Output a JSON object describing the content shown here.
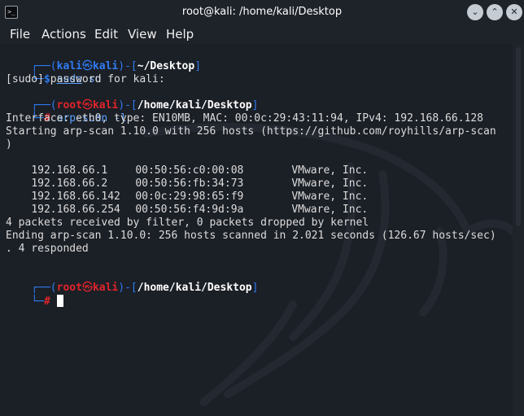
{
  "window": {
    "title": "root@kali: /home/kali/Desktop",
    "app_icon_glyph": ">_",
    "controls": [
      "minimize",
      "maximize",
      "close"
    ]
  },
  "menu": [
    "File",
    "Actions",
    "Edit",
    "View",
    "Help"
  ],
  "glyphs": {
    "top_connector": "┌──",
    "bottom_connector": "└─",
    "dash": "-",
    "open_bracket": "[",
    "close_bracket": "]",
    "open_paren": "(",
    "close_paren": ")",
    "skull": "㉿"
  },
  "prompts": [
    {
      "user": "kali",
      "host": "kali",
      "path": "~/Desktop",
      "symbol": "$"
    },
    {
      "user": "root",
      "host": "kali",
      "path": "/home/kali/Desktop",
      "symbol": "#"
    },
    {
      "user": "root",
      "host": "kali",
      "path": "/home/kali/Desktop",
      "symbol": "#"
    }
  ],
  "commands": {
    "c1_word1": "sudo",
    "c1_word2": " su",
    "c2": "arp-scan -l"
  },
  "output": {
    "sudo_prompt": "[sudo] password for kali:",
    "interface": "Interface: eth0, type: EN10MB, MAC: 00:0c:29:43:11:94, IPv4: 192.168.66.128",
    "starting": "Starting arp-scan 1.10.0 with 256 hosts (https://github.com/royhills/arp-scan",
    "starting_wrap": ")",
    "hosts": [
      {
        "ip": "192.168.66.1",
        "mac": "00:50:56:c0:00:08",
        "vendor": "VMware, Inc."
      },
      {
        "ip": "192.168.66.2",
        "mac": "00:50:56:fb:34:73",
        "vendor": "VMware, Inc."
      },
      {
        "ip": "192.168.66.142",
        "mac": "00:0c:29:98:65:f9",
        "vendor": "VMware, Inc."
      },
      {
        "ip": "192.168.66.254",
        "mac": "00:50:56:f4:9d:9a",
        "vendor": "VMware, Inc."
      }
    ],
    "packets": "4 packets received by filter, 0 packets dropped by kernel",
    "ending": "Ending arp-scan 1.10.0: 256 hosts scanned in 2.021 seconds (126.67 hosts/sec)",
    "ending_wrap": ". 4 responded"
  },
  "colors": {
    "background": "#1b1f26",
    "kali_blue": "#2f7cf2",
    "root_red": "#e0242b",
    "text": "#dcdcdc"
  }
}
